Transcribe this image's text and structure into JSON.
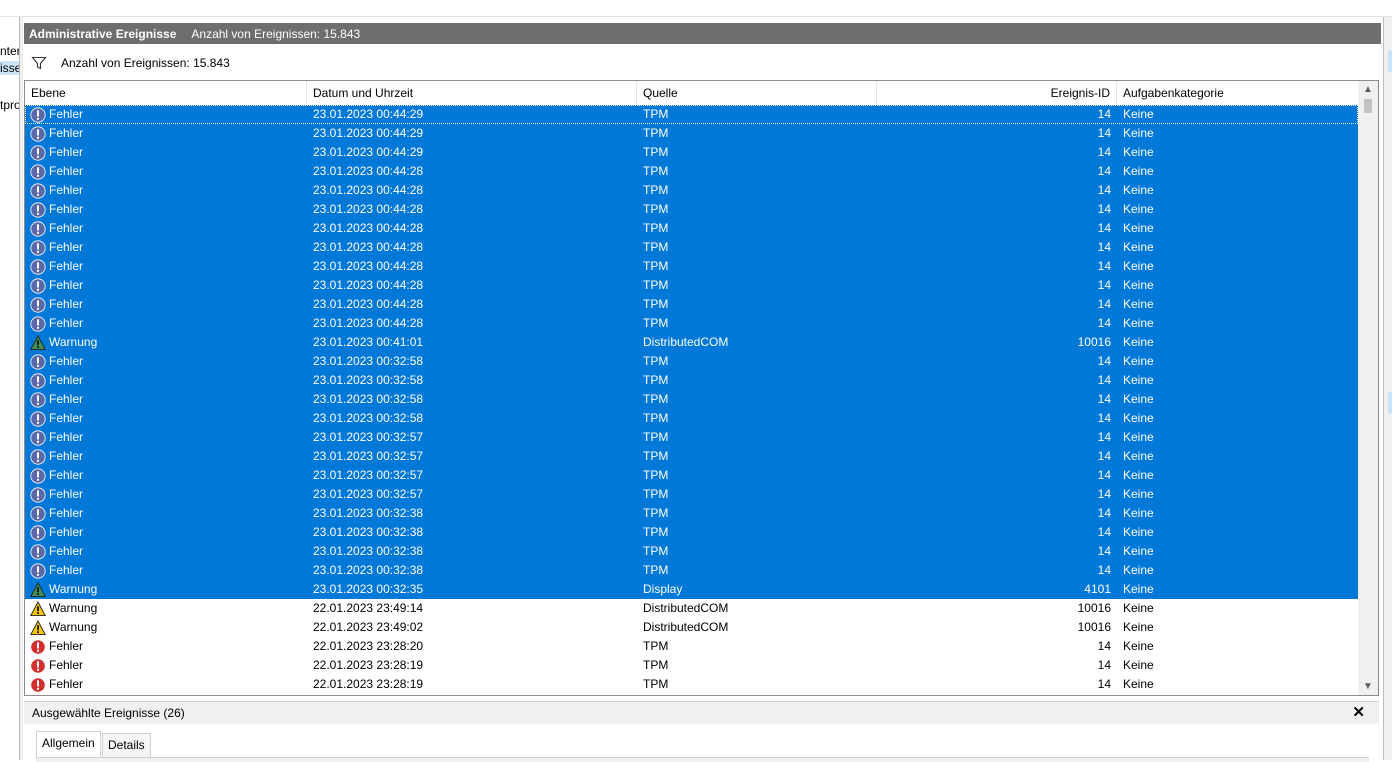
{
  "window": {
    "left_fragments": [
      "nter",
      "isse",
      "tpro"
    ],
    "title": "Administrative Ereignisse",
    "title_count": "Anzahl von Ereignissen: 15.843"
  },
  "filter": {
    "icon": "filter-icon",
    "text": "Anzahl von Ereignissen: 15.843"
  },
  "columns": {
    "level": "Ebene",
    "datetime": "Datum und Uhrzeit",
    "source": "Quelle",
    "event_id": "Ereignis-ID",
    "task_category": "Aufgabenkategorie"
  },
  "colors": {
    "selection": "#0078d7",
    "title_bar": "#6e6e6e",
    "error_icon": "#d32f2f",
    "warning_icon": "#f7c600"
  },
  "events": [
    {
      "level": "Fehler",
      "datetime": "23.01.2023 00:44:29",
      "source": "TPM",
      "event_id": "14",
      "task_category": "Keine",
      "type": "error",
      "selected": true
    },
    {
      "level": "Fehler",
      "datetime": "23.01.2023 00:44:29",
      "source": "TPM",
      "event_id": "14",
      "task_category": "Keine",
      "type": "error",
      "selected": true
    },
    {
      "level": "Fehler",
      "datetime": "23.01.2023 00:44:29",
      "source": "TPM",
      "event_id": "14",
      "task_category": "Keine",
      "type": "error",
      "selected": true
    },
    {
      "level": "Fehler",
      "datetime": "23.01.2023 00:44:28",
      "source": "TPM",
      "event_id": "14",
      "task_category": "Keine",
      "type": "error",
      "selected": true
    },
    {
      "level": "Fehler",
      "datetime": "23.01.2023 00:44:28",
      "source": "TPM",
      "event_id": "14",
      "task_category": "Keine",
      "type": "error",
      "selected": true
    },
    {
      "level": "Fehler",
      "datetime": "23.01.2023 00:44:28",
      "source": "TPM",
      "event_id": "14",
      "task_category": "Keine",
      "type": "error",
      "selected": true
    },
    {
      "level": "Fehler",
      "datetime": "23.01.2023 00:44:28",
      "source": "TPM",
      "event_id": "14",
      "task_category": "Keine",
      "type": "error",
      "selected": true
    },
    {
      "level": "Fehler",
      "datetime": "23.01.2023 00:44:28",
      "source": "TPM",
      "event_id": "14",
      "task_category": "Keine",
      "type": "error",
      "selected": true
    },
    {
      "level": "Fehler",
      "datetime": "23.01.2023 00:44:28",
      "source": "TPM",
      "event_id": "14",
      "task_category": "Keine",
      "type": "error",
      "selected": true
    },
    {
      "level": "Fehler",
      "datetime": "23.01.2023 00:44:28",
      "source": "TPM",
      "event_id": "14",
      "task_category": "Keine",
      "type": "error",
      "selected": true
    },
    {
      "level": "Fehler",
      "datetime": "23.01.2023 00:44:28",
      "source": "TPM",
      "event_id": "14",
      "task_category": "Keine",
      "type": "error",
      "selected": true
    },
    {
      "level": "Fehler",
      "datetime": "23.01.2023 00:44:28",
      "source": "TPM",
      "event_id": "14",
      "task_category": "Keine",
      "type": "error",
      "selected": true
    },
    {
      "level": "Warnung",
      "datetime": "23.01.2023 00:41:01",
      "source": "DistributedCOM",
      "event_id": "10016",
      "task_category": "Keine",
      "type": "warning",
      "selected": true
    },
    {
      "level": "Fehler",
      "datetime": "23.01.2023 00:32:58",
      "source": "TPM",
      "event_id": "14",
      "task_category": "Keine",
      "type": "error",
      "selected": true
    },
    {
      "level": "Fehler",
      "datetime": "23.01.2023 00:32:58",
      "source": "TPM",
      "event_id": "14",
      "task_category": "Keine",
      "type": "error",
      "selected": true
    },
    {
      "level": "Fehler",
      "datetime": "23.01.2023 00:32:58",
      "source": "TPM",
      "event_id": "14",
      "task_category": "Keine",
      "type": "error",
      "selected": true
    },
    {
      "level": "Fehler",
      "datetime": "23.01.2023 00:32:58",
      "source": "TPM",
      "event_id": "14",
      "task_category": "Keine",
      "type": "error",
      "selected": true
    },
    {
      "level": "Fehler",
      "datetime": "23.01.2023 00:32:57",
      "source": "TPM",
      "event_id": "14",
      "task_category": "Keine",
      "type": "error",
      "selected": true
    },
    {
      "level": "Fehler",
      "datetime": "23.01.2023 00:32:57",
      "source": "TPM",
      "event_id": "14",
      "task_category": "Keine",
      "type": "error",
      "selected": true
    },
    {
      "level": "Fehler",
      "datetime": "23.01.2023 00:32:57",
      "source": "TPM",
      "event_id": "14",
      "task_category": "Keine",
      "type": "error",
      "selected": true
    },
    {
      "level": "Fehler",
      "datetime": "23.01.2023 00:32:57",
      "source": "TPM",
      "event_id": "14",
      "task_category": "Keine",
      "type": "error",
      "selected": true
    },
    {
      "level": "Fehler",
      "datetime": "23.01.2023 00:32:38",
      "source": "TPM",
      "event_id": "14",
      "task_category": "Keine",
      "type": "error",
      "selected": true
    },
    {
      "level": "Fehler",
      "datetime": "23.01.2023 00:32:38",
      "source": "TPM",
      "event_id": "14",
      "task_category": "Keine",
      "type": "error",
      "selected": true
    },
    {
      "level": "Fehler",
      "datetime": "23.01.2023 00:32:38",
      "source": "TPM",
      "event_id": "14",
      "task_category": "Keine",
      "type": "error",
      "selected": true
    },
    {
      "level": "Fehler",
      "datetime": "23.01.2023 00:32:38",
      "source": "TPM",
      "event_id": "14",
      "task_category": "Keine",
      "type": "error",
      "selected": true
    },
    {
      "level": "Warnung",
      "datetime": "23.01.2023 00:32:35",
      "source": "Display",
      "event_id": "4101",
      "task_category": "Keine",
      "type": "warning",
      "selected": true
    },
    {
      "level": "Warnung",
      "datetime": "22.01.2023 23:49:14",
      "source": "DistributedCOM",
      "event_id": "10016",
      "task_category": "Keine",
      "type": "warning",
      "selected": false
    },
    {
      "level": "Warnung",
      "datetime": "22.01.2023 23:49:02",
      "source": "DistributedCOM",
      "event_id": "10016",
      "task_category": "Keine",
      "type": "warning",
      "selected": false
    },
    {
      "level": "Fehler",
      "datetime": "22.01.2023 23:28:20",
      "source": "TPM",
      "event_id": "14",
      "task_category": "Keine",
      "type": "error",
      "selected": false
    },
    {
      "level": "Fehler",
      "datetime": "22.01.2023 23:28:19",
      "source": "TPM",
      "event_id": "14",
      "task_category": "Keine",
      "type": "error",
      "selected": false
    },
    {
      "level": "Fehler",
      "datetime": "22.01.2023 23:28:19",
      "source": "TPM",
      "event_id": "14",
      "task_category": "Keine",
      "type": "error",
      "selected": false
    }
  ],
  "details_panel": {
    "title": "Ausgewählte Ereignisse (26)",
    "close_symbol": "✕",
    "tabs": [
      "Allgemein",
      "Details"
    ],
    "active_tab": "Allgemein"
  }
}
